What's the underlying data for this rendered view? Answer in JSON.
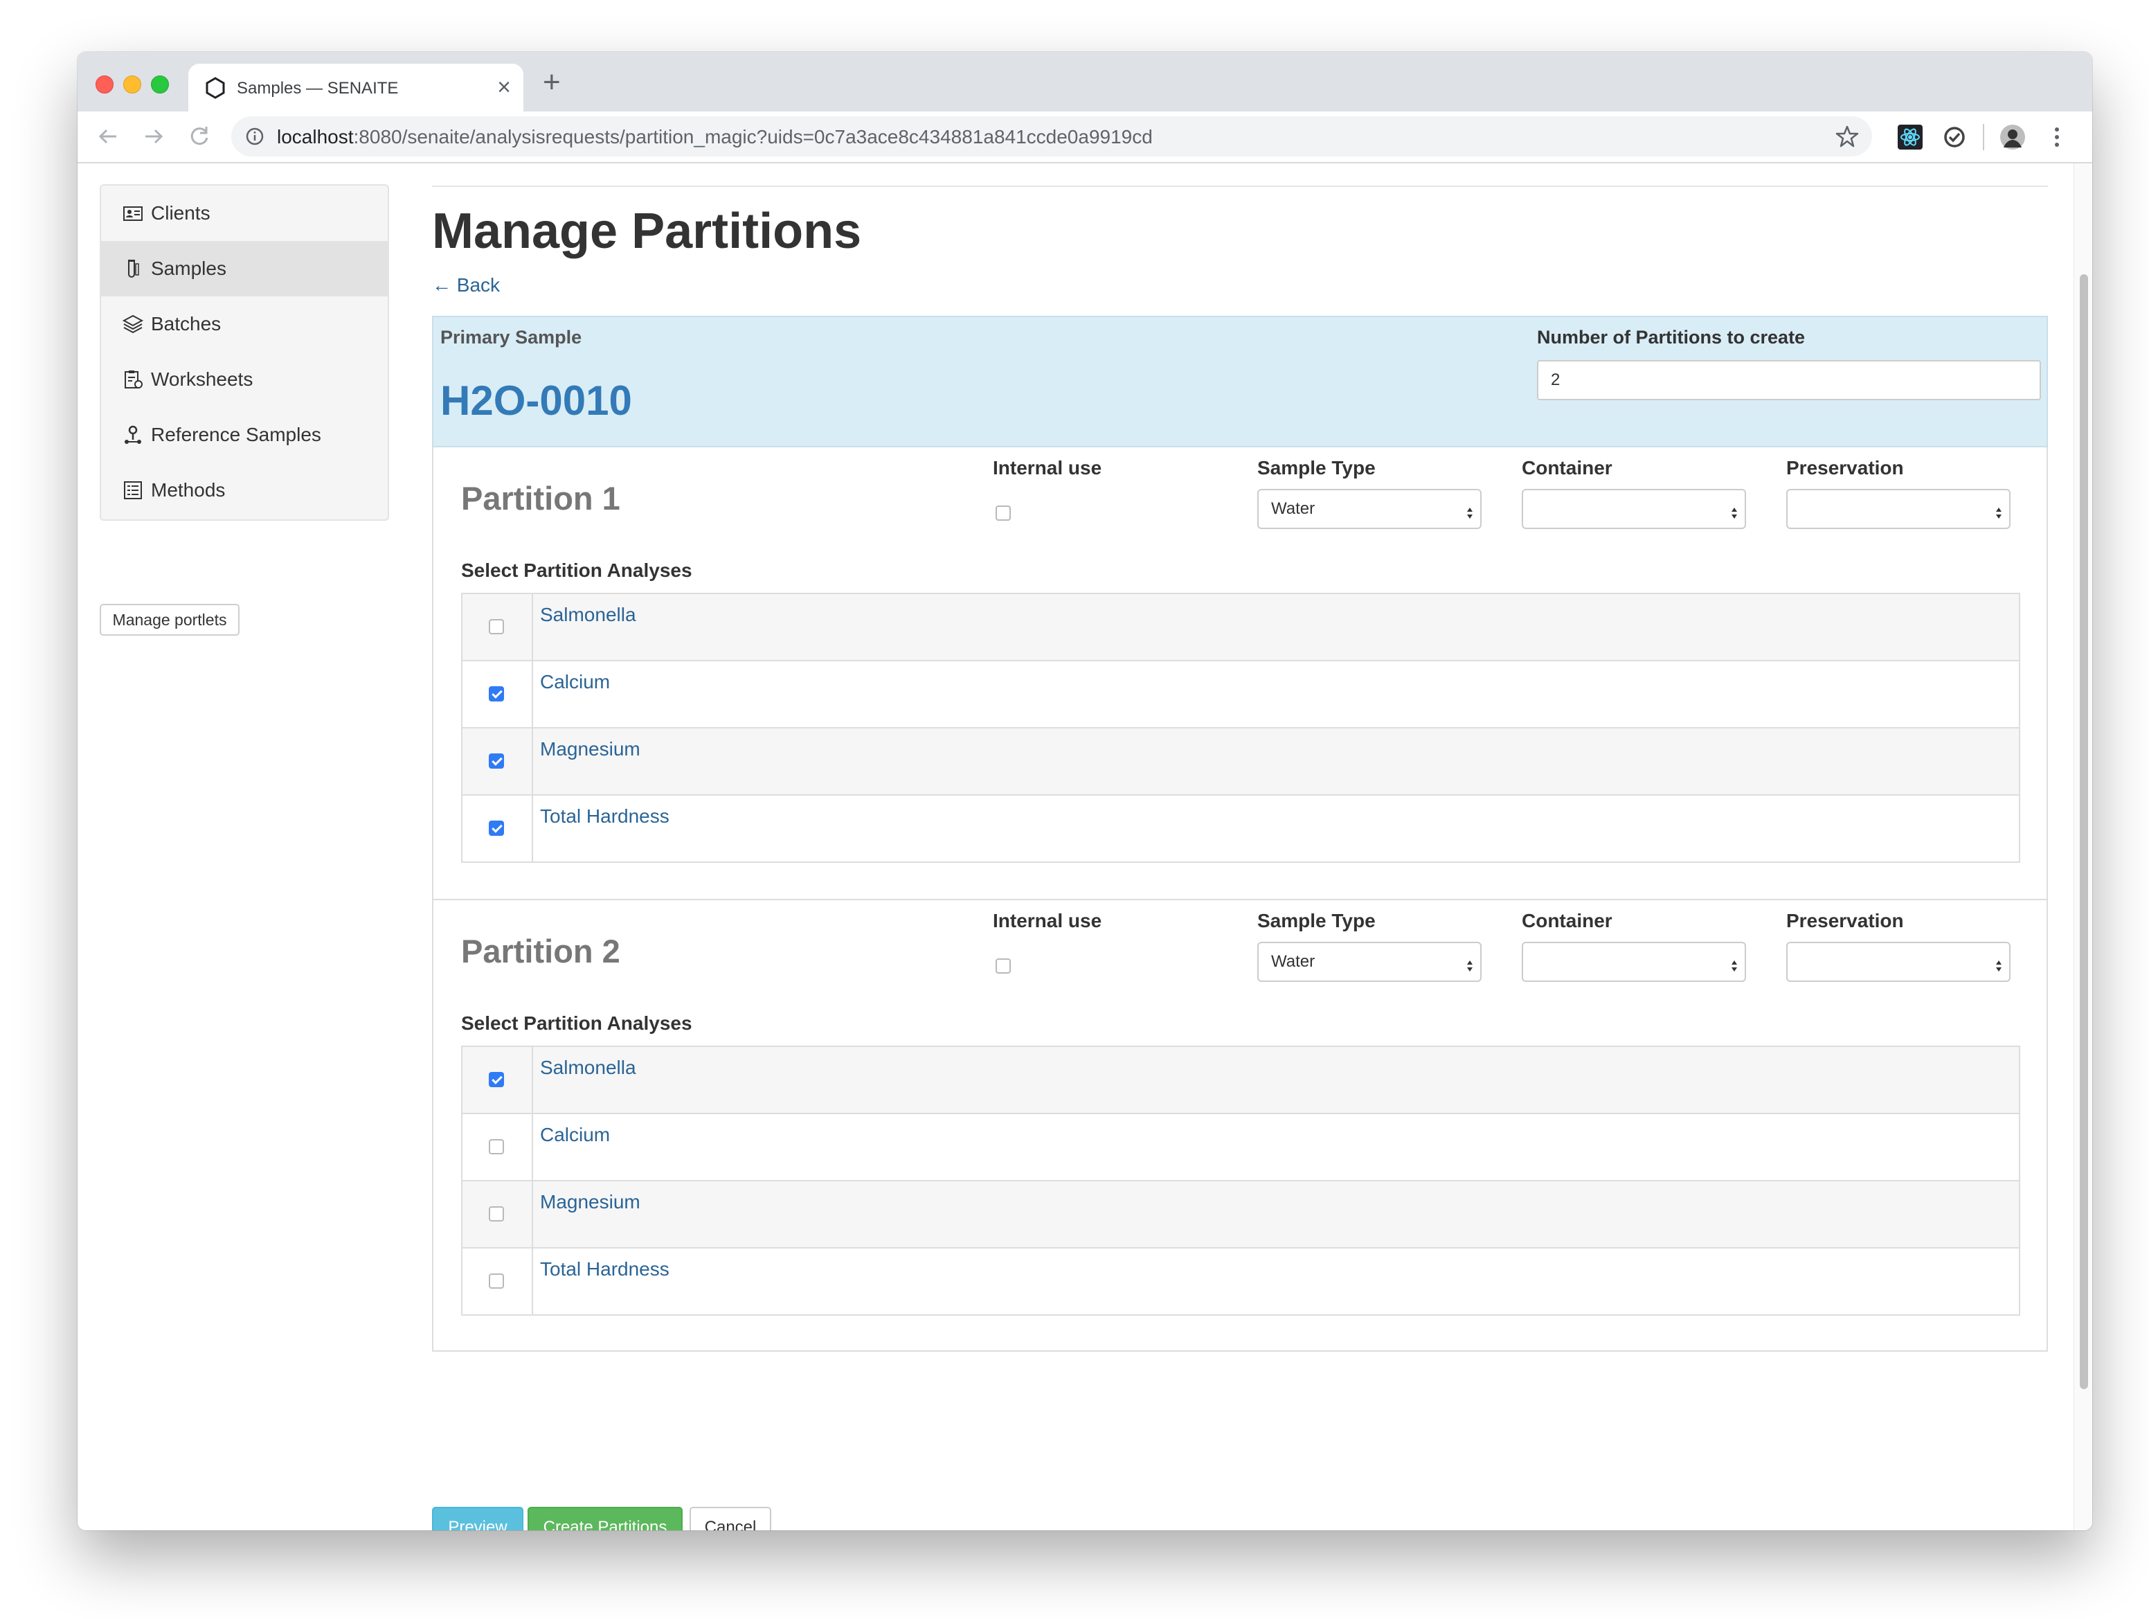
{
  "browser": {
    "tab_title": "Samples — SENAITE",
    "new_tab_symbol": "+",
    "close_symbol": "×",
    "url_host": "localhost",
    "url_rest": ":8080/senaite/analysisrequests/partition_magic?uids=0c7a3ace8c434881a841ccde0a9919cd"
  },
  "sidebar": {
    "items": [
      {
        "label": "Clients",
        "icon": "clients-icon"
      },
      {
        "label": "Samples",
        "icon": "samples-icon",
        "active": true
      },
      {
        "label": "Batches",
        "icon": "batches-icon"
      },
      {
        "label": "Worksheets",
        "icon": "worksheets-icon"
      },
      {
        "label": "Reference Samples",
        "icon": "reference-samples-icon"
      },
      {
        "label": "Methods",
        "icon": "methods-icon"
      }
    ],
    "manage_portlets": "Manage portlets"
  },
  "page": {
    "title": "Manage Partitions",
    "back": "← Back"
  },
  "primary": {
    "label": "Primary Sample",
    "sample_id": "H2O-0010",
    "num_label": "Number of Partitions to create",
    "num_value": "2"
  },
  "columns": {
    "internal_use": "Internal use",
    "sample_type": "Sample Type",
    "container": "Container",
    "preservation": "Preservation",
    "select_analyses": "Select Partition Analyses"
  },
  "partitions": [
    {
      "title": "Partition 1",
      "internal_use": false,
      "sample_type": "Water",
      "container": "",
      "preservation": "",
      "analyses": [
        {
          "name": "Salmonella",
          "checked": false
        },
        {
          "name": "Calcium",
          "checked": true
        },
        {
          "name": "Magnesium",
          "checked": true
        },
        {
          "name": "Total Hardness",
          "checked": true
        }
      ]
    },
    {
      "title": "Partition 2",
      "internal_use": false,
      "sample_type": "Water",
      "container": "",
      "preservation": "",
      "analyses": [
        {
          "name": "Salmonella",
          "checked": true
        },
        {
          "name": "Calcium",
          "checked": false
        },
        {
          "name": "Magnesium",
          "checked": false
        },
        {
          "name": "Total Hardness",
          "checked": false
        }
      ]
    }
  ],
  "buttons": {
    "preview": "Preview",
    "create": "Create Partitions",
    "cancel": "Cancel"
  },
  "colors": {
    "accent_link": "#2a6496",
    "primary_bg": "#d9edf7",
    "preview_btn": "#5bc0de",
    "create_btn": "#5cb85c",
    "checkbox_checked": "#2f7bf5"
  }
}
